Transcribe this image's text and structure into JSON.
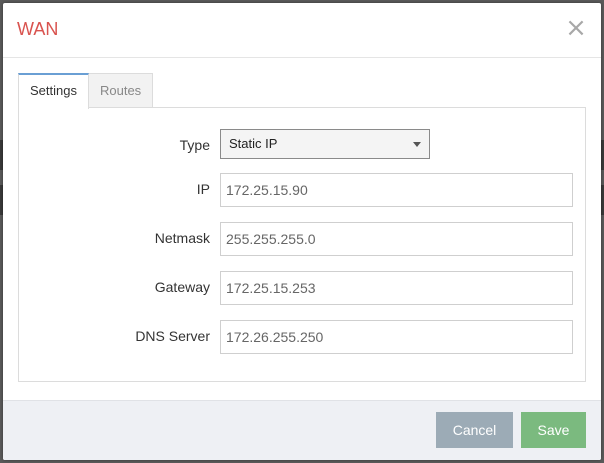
{
  "modal": {
    "title": "WAN",
    "close_glyph": "×"
  },
  "tabs": [
    {
      "label": "Settings",
      "active": true
    },
    {
      "label": "Routes",
      "active": false
    }
  ],
  "form": {
    "type": {
      "label": "Type",
      "value": "Static IP"
    },
    "ip": {
      "label": "IP",
      "value": "172.25.15.90"
    },
    "netmask": {
      "label": "Netmask",
      "value": "255.255.255.0"
    },
    "gateway": {
      "label": "Gateway",
      "value": "172.25.15.253"
    },
    "dns": {
      "label": "DNS Server",
      "value": "172.26.255.250"
    }
  },
  "footer": {
    "cancel_label": "Cancel",
    "save_label": "Save"
  },
  "colors": {
    "title": "#d9534f",
    "tab_active_border": "#6a9fd4",
    "cancel": "#9cabb6",
    "save": "#7bba7f"
  }
}
